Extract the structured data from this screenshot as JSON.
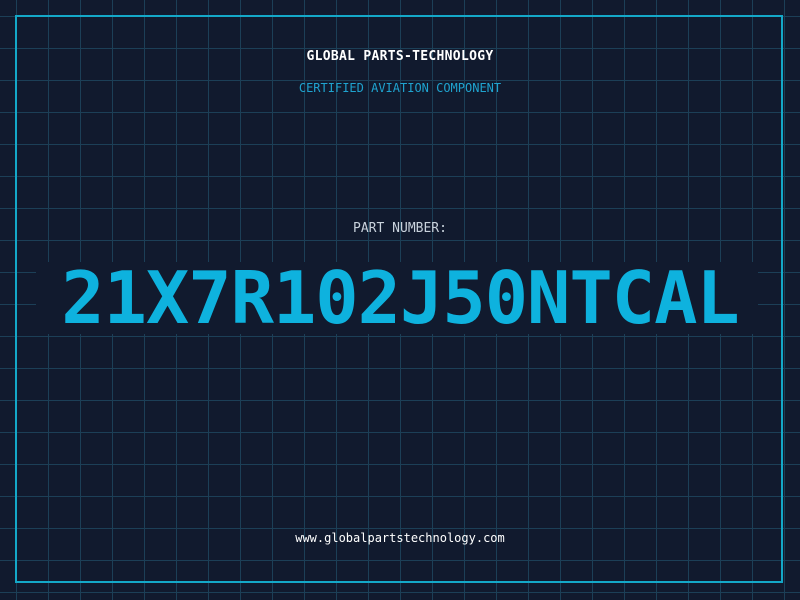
{
  "header": {
    "company": "GLOBAL PARTS-TECHNOLOGY",
    "subtitle": "CERTIFIED AVIATION COMPONENT"
  },
  "part": {
    "label": "PART NUMBER:",
    "number": "21X7R102J50NTCAL"
  },
  "footer": {
    "website": "www.globalpartstechnology.com"
  },
  "colors": {
    "background": "#111a2e",
    "grid": "#1c3f57",
    "accent": "#0eb2de",
    "frame": "#14a8c8",
    "text": "#ffffff"
  }
}
